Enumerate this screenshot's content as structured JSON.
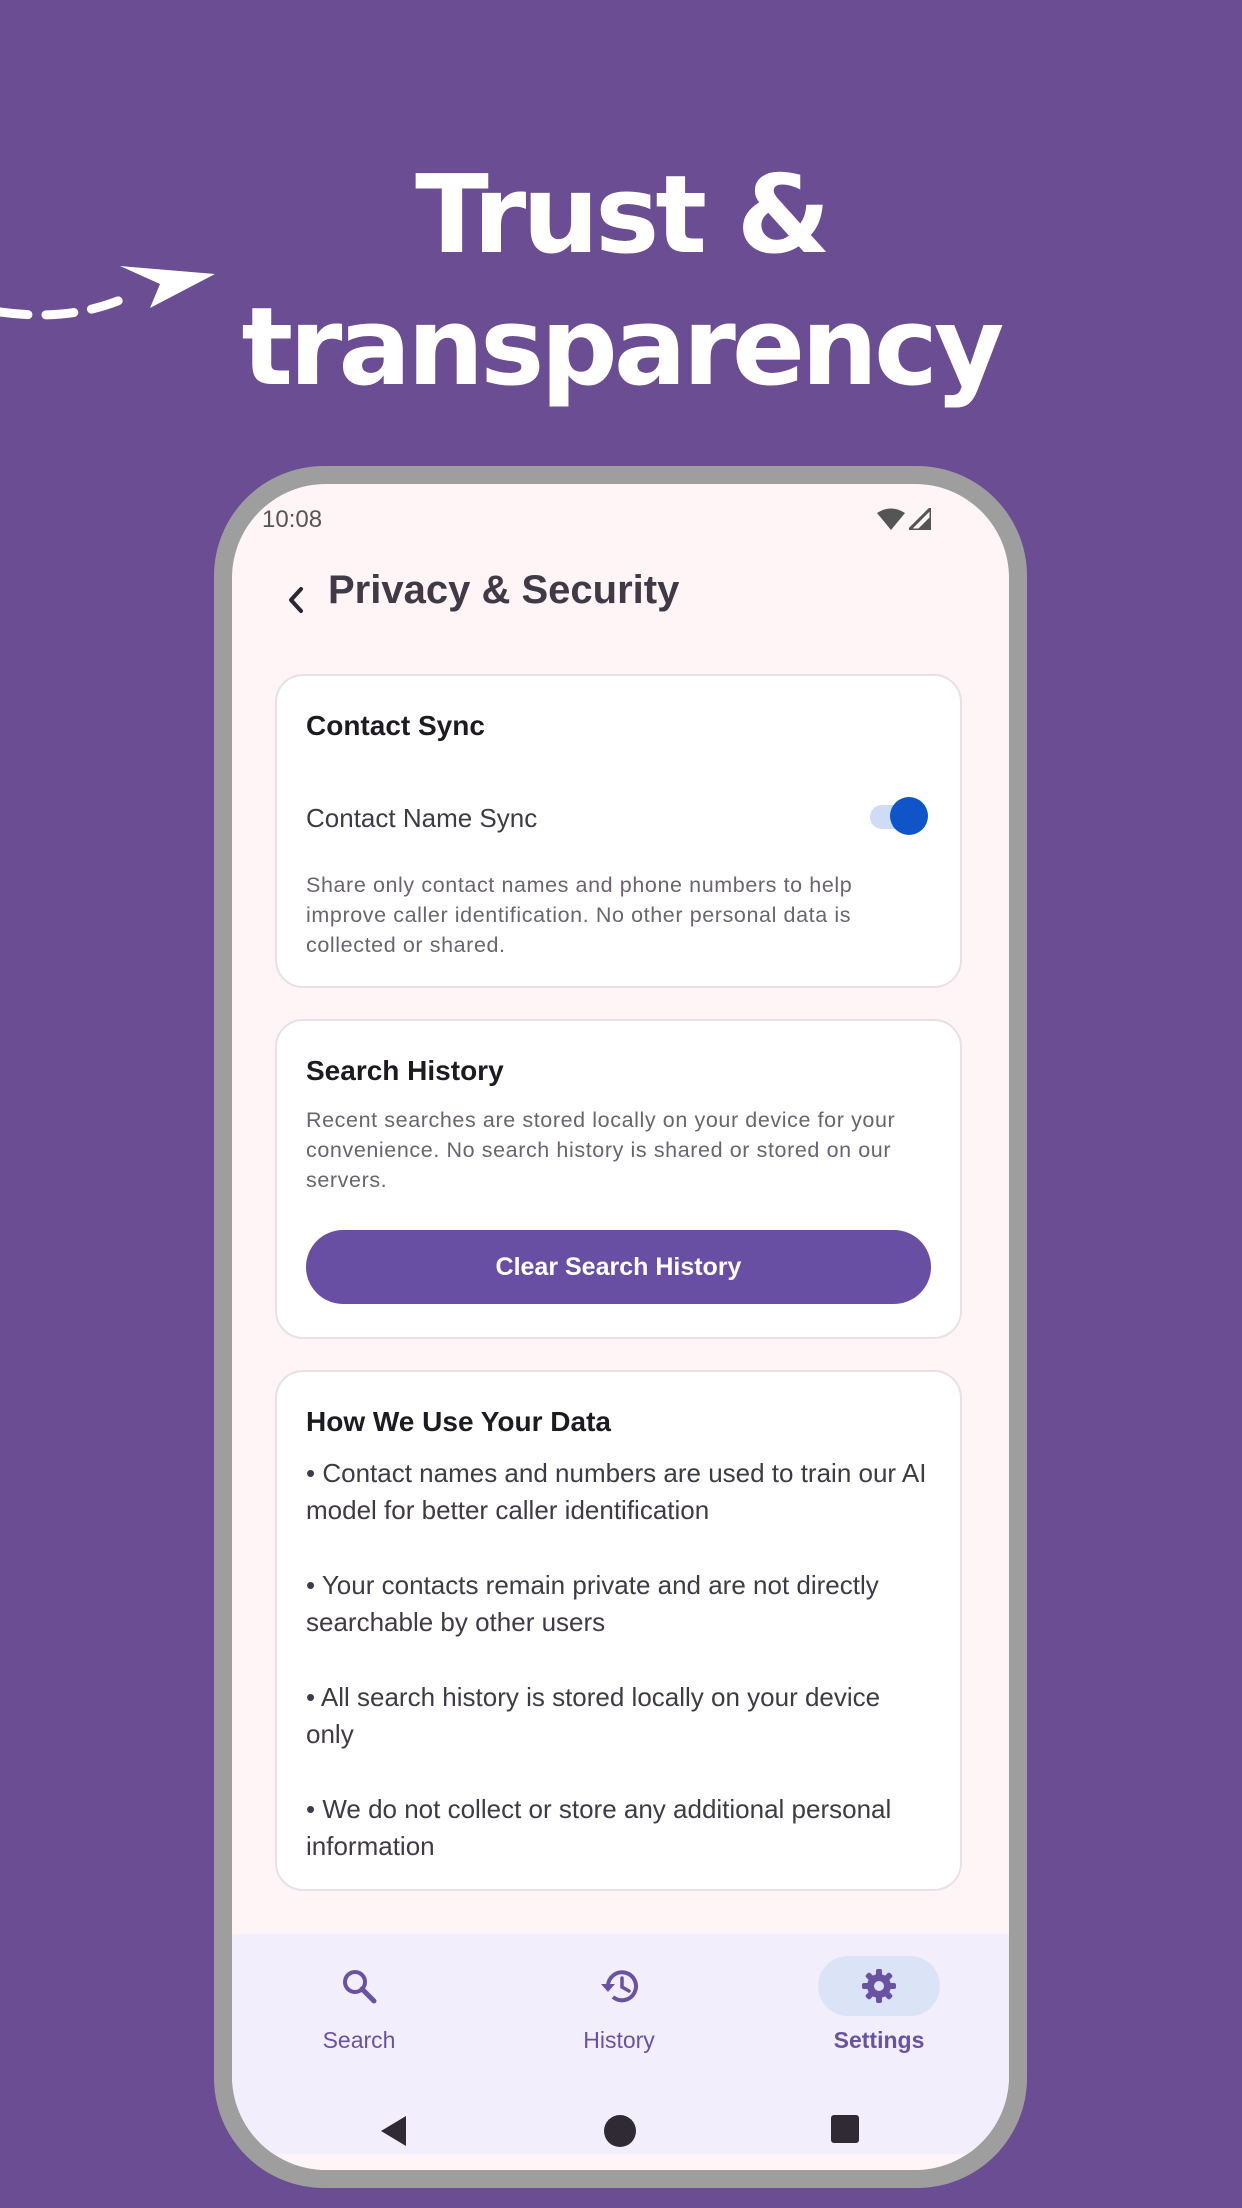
{
  "headline": {
    "line1": "Trust &",
    "line2": "transparency"
  },
  "status_bar": {
    "time": "10:08",
    "icons": [
      "wifi-icon",
      "signal-icon"
    ]
  },
  "app_bar": {
    "back_icon": "chevron-left-icon",
    "title": "Privacy & Security"
  },
  "contact_sync": {
    "title": "Contact Sync",
    "toggle_label": "Contact Name Sync",
    "toggle_on": true,
    "description": "Share only contact names and phone numbers to help improve caller identification. No other personal data is collected or shared."
  },
  "search_history": {
    "title": "Search History",
    "description": "Recent searches are stored locally on your device for your convenience. No search history is shared or stored on our servers.",
    "button_label": "Clear Search History"
  },
  "data_usage": {
    "title": "How We Use Your Data",
    "bullets": [
      "• Contact names and numbers are used to train our AI model for better caller identification",
      "• Your contacts remain private and are not directly searchable by other users",
      "• All search history is stored locally on your device only",
      "• We do not collect or store any additional personal information"
    ]
  },
  "bottom_nav": {
    "items": [
      {
        "label": "Search",
        "icon": "search-icon",
        "active": false
      },
      {
        "label": "History",
        "icon": "history-icon",
        "active": false
      },
      {
        "label": "Settings",
        "icon": "gear-icon",
        "active": true
      }
    ]
  },
  "system_nav": [
    "back-triangle-icon",
    "home-circle-icon",
    "recents-square-icon"
  ],
  "colors": {
    "background": "#6a4d92",
    "primary": "#684fa3",
    "toggle_thumb": "#0f55c9",
    "screen_bg": "#fff4f6",
    "nav_bg": "#f2eefb"
  }
}
